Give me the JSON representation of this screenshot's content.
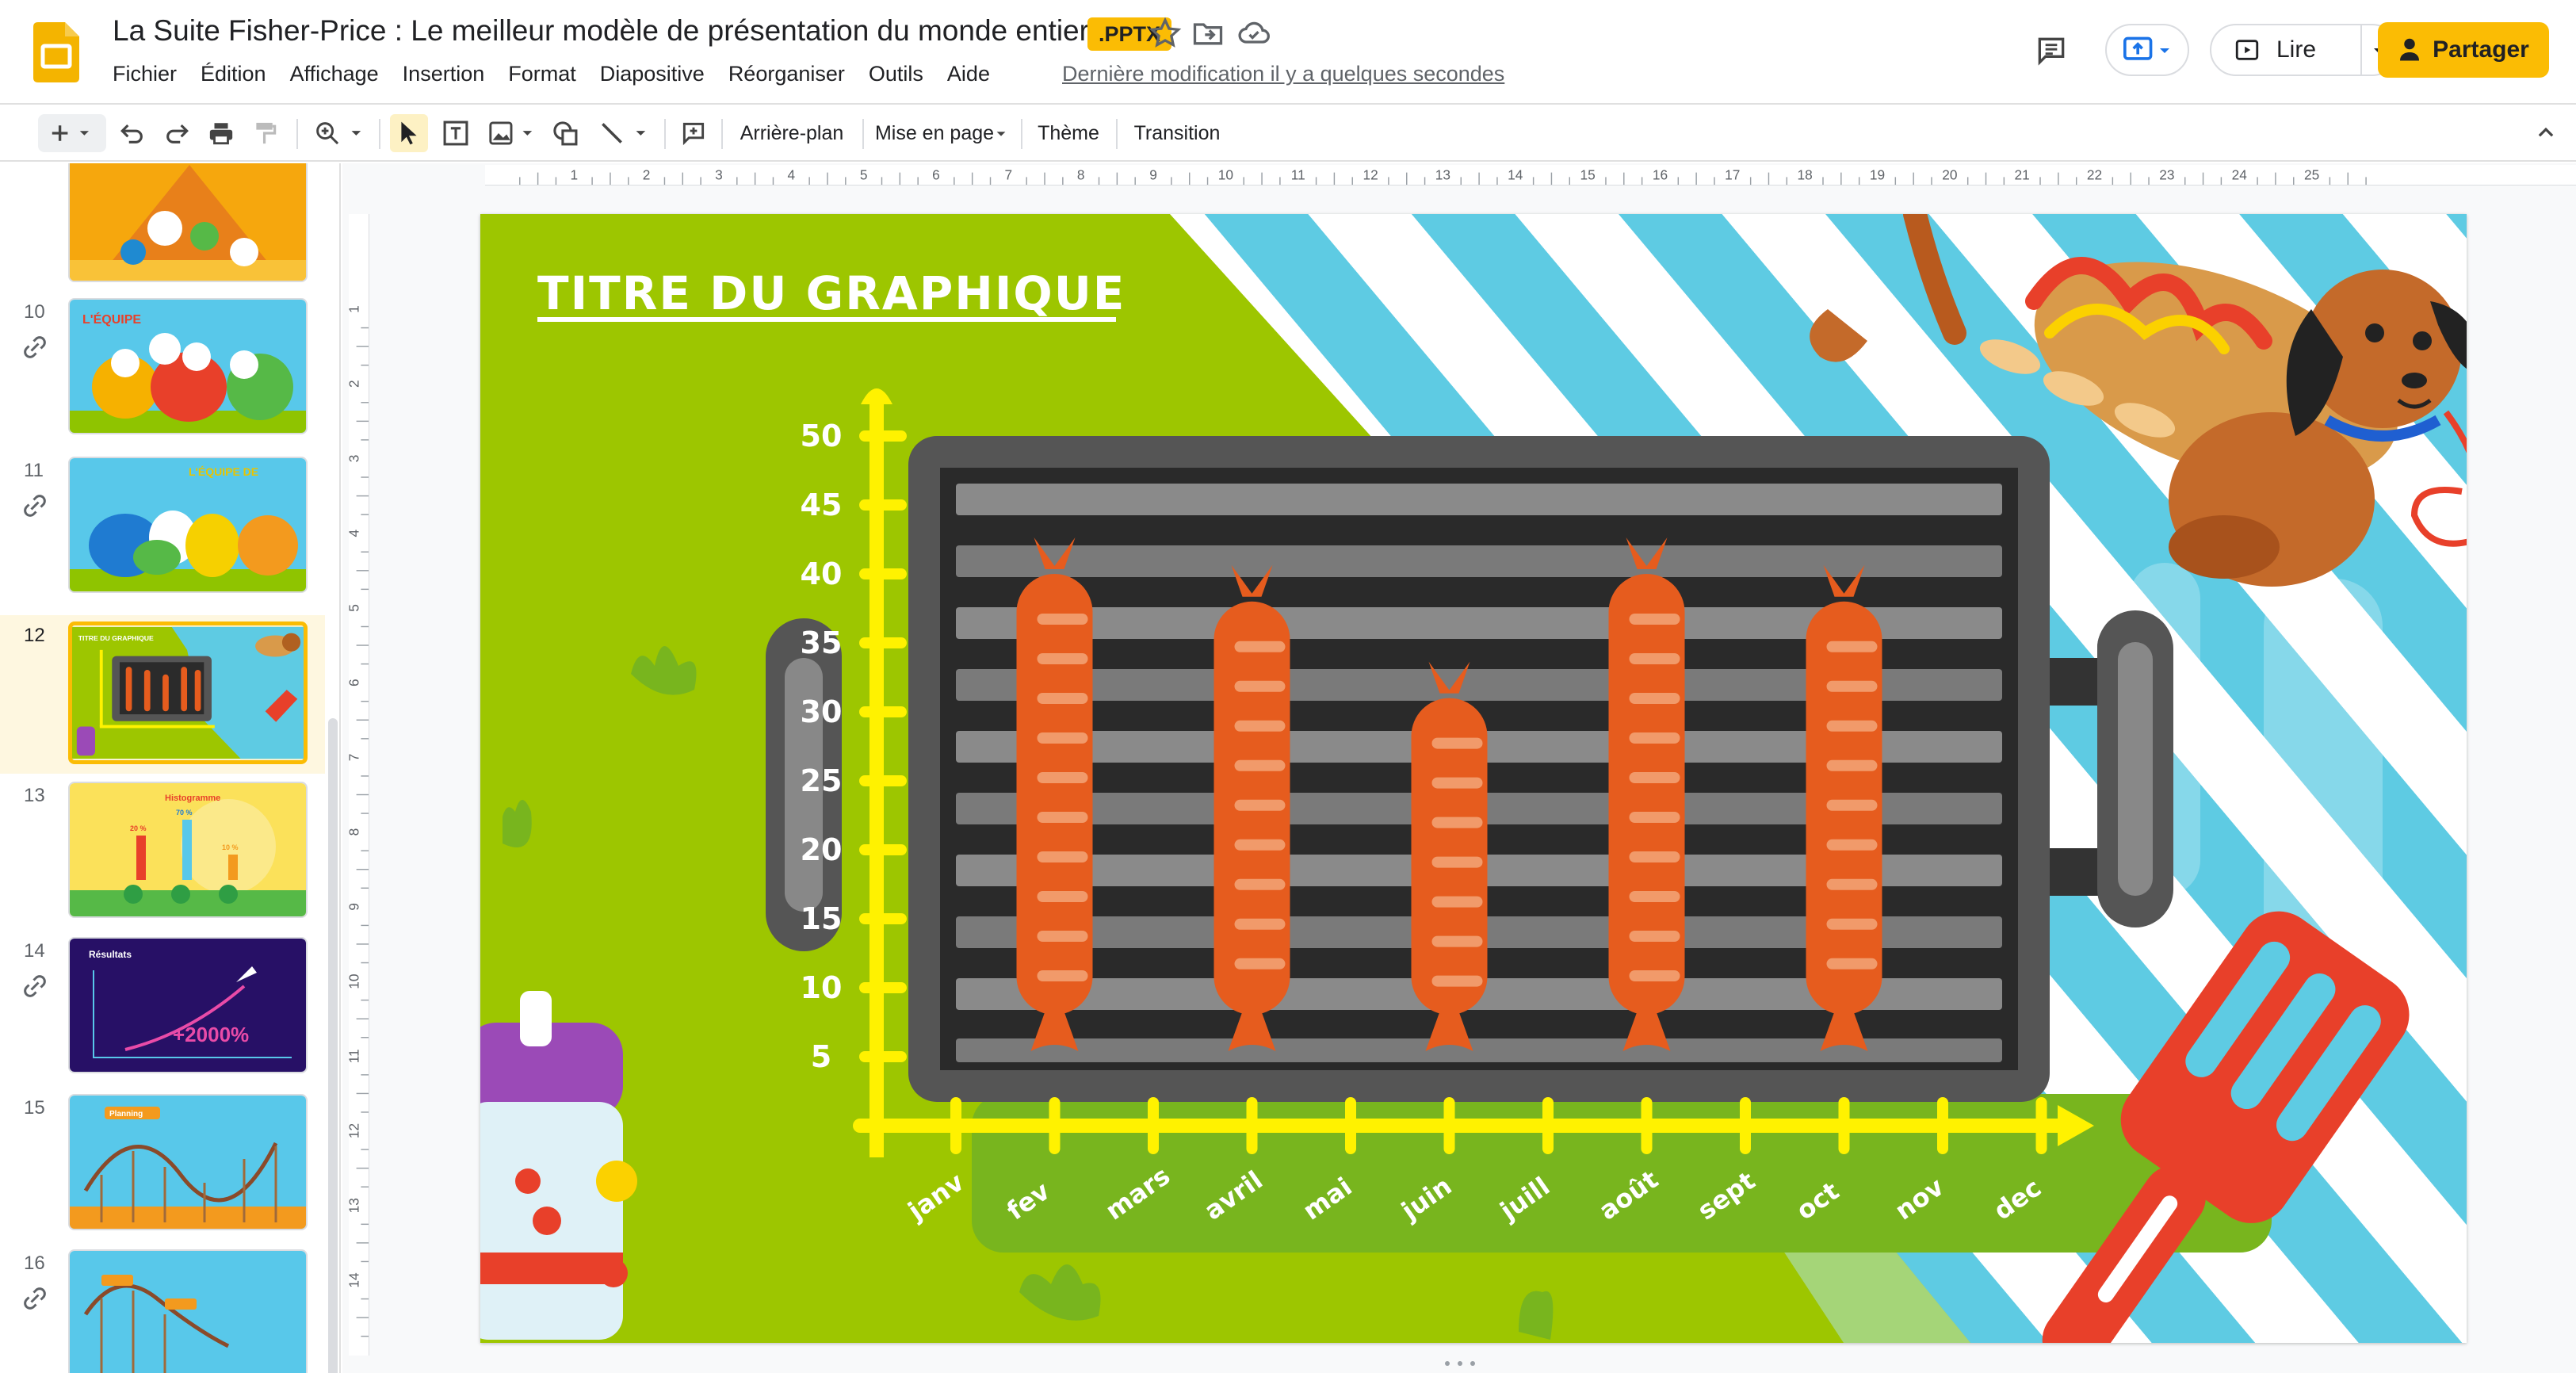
{
  "document": {
    "title": "La Suite Fisher-Price : Le meilleur modèle de présentation du monde entier",
    "badge": ".PPTX",
    "last_edit": "Dernière modification il y a quelques secondes"
  },
  "menu": [
    "Fichier",
    "Édition",
    "Affichage",
    "Insertion",
    "Format",
    "Diapositive",
    "Réorganiser",
    "Outils",
    "Aide"
  ],
  "header_actions": {
    "slideshow_label": "Lire",
    "share_label": "Partager"
  },
  "toolbar": {
    "background": "Arrière-plan",
    "layout": "Mise en page",
    "theme": "Thème",
    "transition": "Transition"
  },
  "ruler": {
    "horizontal": [
      "1",
      "2",
      "3",
      "4",
      "5",
      "6",
      "7",
      "8",
      "9",
      "10",
      "11",
      "12",
      "13",
      "14",
      "15",
      "16",
      "17",
      "18",
      "19",
      "20",
      "21",
      "22",
      "23",
      "24",
      "25"
    ],
    "vertical": [
      "1",
      "2",
      "3",
      "4",
      "5",
      "6",
      "7",
      "8",
      "9",
      "10",
      "11",
      "12",
      "13",
      "14"
    ]
  },
  "filmstrip": {
    "slides": [
      {
        "number": "",
        "linked": false
      },
      {
        "number": "10",
        "linked": true
      },
      {
        "number": "11",
        "linked": true
      },
      {
        "number": "12",
        "linked": false,
        "active": true
      },
      {
        "number": "13",
        "linked": false
      },
      {
        "number": "14",
        "linked": true
      },
      {
        "number": "15",
        "linked": false
      },
      {
        "number": "16",
        "linked": true
      }
    ],
    "thumb_texts": {
      "s10_title": "L'ÉQUIPE",
      "s11_title": "L'ÉQUIPE DE",
      "s12_title": "TITRE DU GRAPHIQUE",
      "s13_title": "Histogramme",
      "s13_labels": [
        "20 %",
        "70 %",
        "10 %"
      ],
      "s14_title": "Résultats",
      "s14_value": "+2000%",
      "s15_title": "Planning"
    }
  },
  "chart_data": {
    "type": "bar",
    "title": "TITRE DU GRAPHIQUE",
    "categories": [
      "janv",
      "fev",
      "mars",
      "avril",
      "mai",
      "juin",
      "juill",
      "août",
      "sept",
      "oct",
      "nov",
      "dec"
    ],
    "y_ticks": [
      50,
      45,
      40,
      35,
      30,
      25,
      20,
      15,
      10,
      5
    ],
    "ylim": [
      0,
      50
    ],
    "series": [
      {
        "values": [
          null,
          40,
          null,
          38,
          null,
          31,
          null,
          40,
          null,
          38,
          null,
          null
        ]
      }
    ]
  },
  "colors": {
    "accent": "#fbbc04",
    "slide_green": "#9dc600",
    "stripe_blue": "#5ecbe3",
    "axis_yellow": "#fff200",
    "sausage": "#e65c1e"
  }
}
